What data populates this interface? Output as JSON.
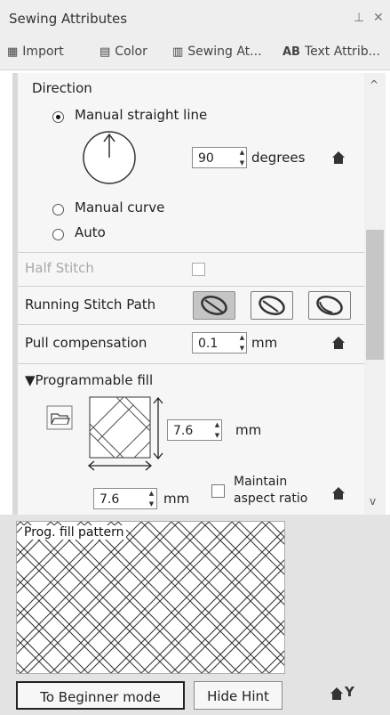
{
  "window": {
    "title": "Sewing Attributes",
    "pin_icon": "pin-icon",
    "close_icon": "close-icon"
  },
  "tabs": [
    {
      "label": "Import",
      "icon": "import-icon"
    },
    {
      "label": "Color",
      "icon": "color-icon"
    },
    {
      "label": "Sewing At...",
      "icon": "sewing-icon"
    },
    {
      "label": "Text Attrib...",
      "icon": "AB"
    }
  ],
  "direction": {
    "heading": "Direction",
    "manual_straight": "Manual straight line",
    "angle_value": "90",
    "angle_unit": "degrees",
    "manual_curve": "Manual curve",
    "auto": "Auto",
    "selected": "Manual straight line"
  },
  "half_stitch": {
    "label": "Half Stitch",
    "checked": false
  },
  "running_stitch": {
    "label": "Running Stitch Path",
    "selected_index": 0
  },
  "pull_comp": {
    "label": "Pull compensation",
    "value": "0.1",
    "unit": "mm"
  },
  "prog_fill": {
    "heading": "Programmable fill",
    "height_value": "7.6",
    "height_unit": "mm",
    "width_value": "7.6",
    "width_unit": "mm",
    "maintain_line1": "Maintain",
    "maintain_line2": "aspect ratio",
    "maintain_checked": false
  },
  "hint": {
    "label": "Prog. fill pattern"
  },
  "buttons": {
    "beginner": "To Beginner mode",
    "hide_hint": "Hide Hint",
    "help_icon": "house-help-icon"
  }
}
